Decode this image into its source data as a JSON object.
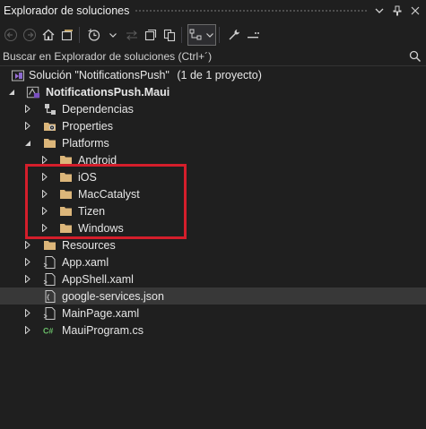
{
  "window": {
    "title": "Explorador de soluciones"
  },
  "search": {
    "placeholder": "Buscar en Explorador de soluciones (Ctrl+´)"
  },
  "tree": {
    "solution_label": "Solución \"NotificationsPush\"",
    "solution_extra": "(1 de 1 proyecto)",
    "project_label": "NotificationsPush.Maui",
    "items": [
      {
        "label": "Dependencias",
        "icon": "dependencies-icon"
      },
      {
        "label": "Properties",
        "icon": "properties-icon"
      },
      {
        "label": "Platforms",
        "icon": "folder-icon"
      },
      {
        "label": "Android",
        "icon": "folder-icon"
      },
      {
        "label": "iOS",
        "icon": "folder-icon"
      },
      {
        "label": "MacCatalyst",
        "icon": "folder-icon"
      },
      {
        "label": "Tizen",
        "icon": "folder-icon"
      },
      {
        "label": "Windows",
        "icon": "folder-icon"
      },
      {
        "label": "Resources",
        "icon": "folder-icon"
      },
      {
        "label": "App.xaml",
        "icon": "xaml-file-icon"
      },
      {
        "label": "AppShell.xaml",
        "icon": "xaml-file-icon"
      },
      {
        "label": "google-services.json",
        "icon": "json-file-icon"
      },
      {
        "label": "MainPage.xaml",
        "icon": "xaml-file-icon"
      },
      {
        "label": "MauiProgram.cs",
        "icon": "csharp-file-icon"
      }
    ]
  },
  "colors": {
    "background": "#1f1f1f",
    "selection": "#383838",
    "highlight_box": "#d41e2b",
    "folder": "#dcb67a",
    "csharp": "#6abf69"
  }
}
